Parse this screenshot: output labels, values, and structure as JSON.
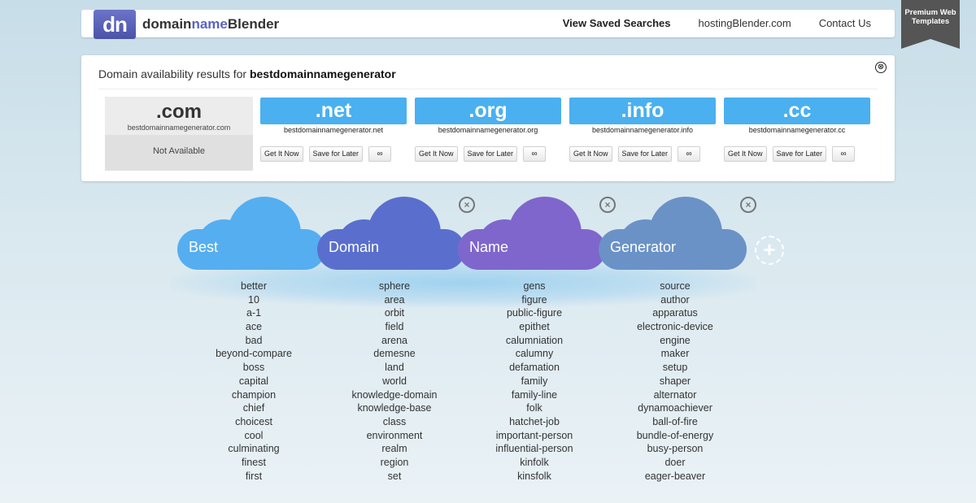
{
  "header": {
    "logo_mark": "dn",
    "logo_parts": [
      "domain",
      "name",
      "Blender"
    ],
    "nav": [
      "View Saved Searches",
      "hostingBlender.com",
      "Contact Us"
    ],
    "ribbon": "Premium Web Templates"
  },
  "results": {
    "heading_prefix": "Domain availability results for",
    "query": "bestdomainnamegenerator",
    "close_icon": "⊗",
    "unavailable": {
      "ext": ".com",
      "domain": "bestdomainnamegenerator.com",
      "status": "Not Available"
    },
    "available": [
      {
        "ext": ".net",
        "domain": "bestdomainnamegenerator.net"
      },
      {
        "ext": ".org",
        "domain": "bestdomainnamegenerator.org"
      },
      {
        "ext": ".info",
        "domain": "bestdomainnamegenerator.info"
      },
      {
        "ext": ".cc",
        "domain": "bestdomainnamegenerator.cc"
      }
    ],
    "buttons": {
      "get": "Get It Now",
      "save": "Save for Later",
      "link_icon": "∞"
    }
  },
  "clouds": [
    {
      "label": "Best",
      "color": "#55aef0"
    },
    {
      "label": "Domain",
      "color": "#5a6fcd"
    },
    {
      "label": "Name",
      "color": "#7f66cc"
    },
    {
      "label": "Generator",
      "color": "#6a92c6"
    }
  ],
  "cloud_close_icon": "×",
  "add_icon": "+",
  "words": [
    [
      "better",
      "10",
      "a-1",
      "ace",
      "bad",
      "beyond-compare",
      "boss",
      "capital",
      "champion",
      "chief",
      "choicest",
      "cool",
      "culminating",
      "finest",
      "first"
    ],
    [
      "sphere",
      "area",
      "orbit",
      "field",
      "arena",
      "demesne",
      "land",
      "world",
      "knowledge-domain",
      "knowledge-base",
      "class",
      "environment",
      "realm",
      "region",
      "set"
    ],
    [
      "gens",
      "figure",
      "public-figure",
      "epithet",
      "calumniation",
      "calumny",
      "defamation",
      "family",
      "family-line",
      "folk",
      "hatchet-job",
      "important-person",
      "influential-person",
      "kinfolk",
      "kinsfolk"
    ],
    [
      "source",
      "author",
      "apparatus",
      "electronic-device",
      "engine",
      "maker",
      "setup",
      "shaper",
      "alternator",
      "dynamoachiever",
      "ball-of-fire",
      "bundle-of-energy",
      "busy-person",
      "doer",
      "eager-beaver"
    ]
  ]
}
